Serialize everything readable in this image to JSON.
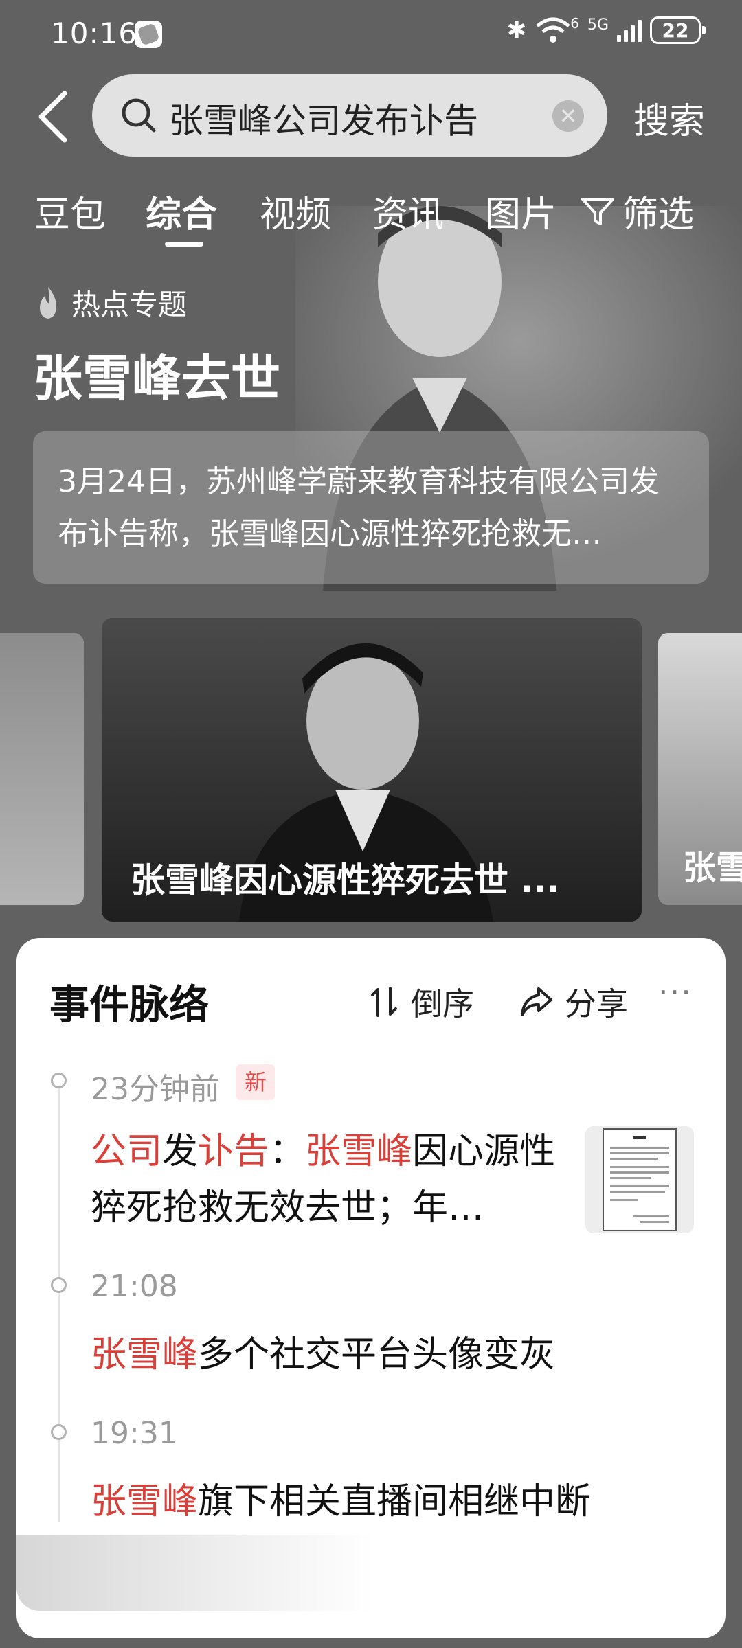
{
  "status_bar": {
    "time": "10:16",
    "bluetooth_icon": "bluetooth-icon",
    "wifi_icon": "wifi-icon",
    "wifi_superscript": "6",
    "network": "5G",
    "battery": "22"
  },
  "search": {
    "query": "张雪峰公司发布讣告",
    "submit_label": "搜索"
  },
  "tabs": [
    {
      "label": "豆包"
    },
    {
      "label": "综合"
    },
    {
      "label": "视频"
    },
    {
      "label": "资讯"
    },
    {
      "label": "图片"
    }
  ],
  "filter_label": "筛选",
  "hot_topic": {
    "label": "热点专题",
    "title": "张雪峰去世",
    "summary": "3月24日，苏州峰学蔚来教育科技有限公司发布讣告称，张雪峰因心源性猝死抢救无…"
  },
  "carousel": {
    "main_caption": "张雪峰因心源性猝死去世 ...",
    "side_caption": "张雪"
  },
  "timeline": {
    "title": "事件脉络",
    "sort_label": "倒序",
    "share_label": "分享",
    "more_label": "···",
    "new_badge": "新",
    "items": [
      {
        "time": "23分钟前",
        "segments": [
          "公司",
          "发",
          "讣告",
          "：",
          "张雪峰",
          "因心源性猝死抢救无效去世；年…"
        ]
      },
      {
        "time": "21:08",
        "segments": [
          "张雪峰",
          "多个社交平台头像变灰"
        ]
      },
      {
        "time": "19:31",
        "segments": [
          "张雪峰",
          "旗下相关直播间相继中断"
        ]
      }
    ]
  },
  "colors": {
    "highlight": "#d9403a",
    "background": "#616161",
    "card": "#ffffff"
  }
}
